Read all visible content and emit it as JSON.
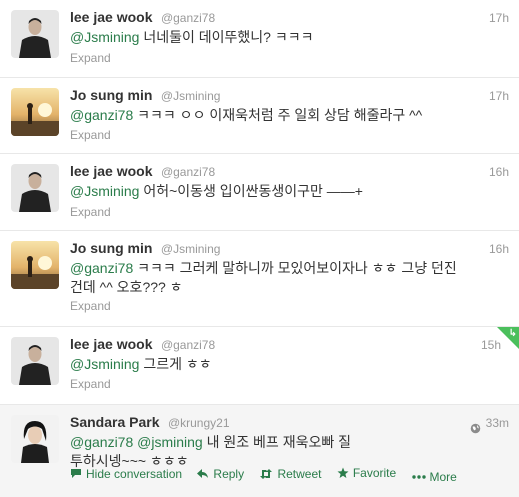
{
  "tweets": [
    {
      "fullname": "lee jae wook",
      "username": "@ganzi78",
      "time": "17h",
      "mention": "@Jsmining",
      "text_line1": " 너네둘이 데이뚜했니? ㅋㅋㅋ",
      "text_line2": "",
      "expand": "Expand"
    },
    {
      "fullname": "Jo sung min",
      "username": "@Jsmining",
      "time": "17h",
      "mention": "@ganzi78",
      "text_line1": " ㅋㅋㅋ ㅇㅇ 이재욱처럼 주 일회 상담 해줄라구 ^^",
      "text_line2": "",
      "expand": "Expand"
    },
    {
      "fullname": "lee jae wook",
      "username": "@ganzi78",
      "time": "16h",
      "mention": "@Jsmining",
      "text_line1": " 어허~이동생 입이싼동생이구만 ——+",
      "text_line2": "",
      "expand": "Expand"
    },
    {
      "fullname": "Jo sung min",
      "username": "@Jsmining",
      "time": "16h",
      "mention": "@ganzi78",
      "text_line1": " ㅋㅋㅋ 그러케 말하니까 모있어보이자나 ㅎㅎ 그냥 던진",
      "text_line2": "건데 ^^ 오호??? ㅎ",
      "expand": "Expand"
    },
    {
      "fullname": "lee jae wook",
      "username": "@ganzi78",
      "time": "15h",
      "mention": "@Jsmining",
      "text_line1": " 그르게 ㅎㅎ",
      "text_line2": "",
      "expand": "Expand"
    },
    {
      "fullname": "Sandara Park",
      "username": "@krungy21",
      "time": "33m",
      "mention": "@ganzi78",
      "mention2": "@jsmining",
      "text_line1": " 내 원조 베프 재욱오빠 질",
      "text_line2": "투하시넹~~~ ㅎㅎㅎ"
    }
  ],
  "actions": {
    "hide": "Hide conversation",
    "reply": "Reply",
    "retweet": "Retweet",
    "favorite": "Favorite",
    "more": "More"
  },
  "colors": {
    "link": "#2a7c4a",
    "muted": "#999999",
    "corner": "#4bbf5c"
  },
  "icons": [
    "conversation-icon",
    "reply-icon",
    "retweet-icon",
    "favorite-icon",
    "more-icon",
    "globe-icon"
  ]
}
